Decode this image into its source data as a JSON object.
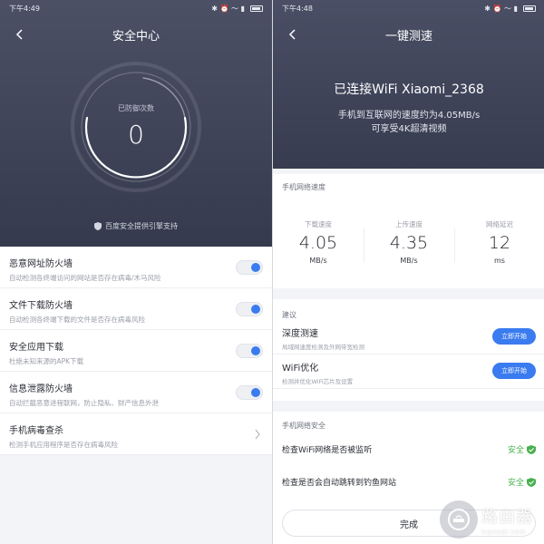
{
  "left": {
    "status": {
      "time": "下午4:49",
      "icons": "✱ ⏰ 〜 ▮"
    },
    "title": "安全中心",
    "ring": {
      "label": "已防御次数",
      "count": "0"
    },
    "powered_by": "百度安全提供引擎支持",
    "items": [
      {
        "title": "恶意网址防火墙",
        "desc": "自动检测各终端访问的网站是否存在病毒/木马风险",
        "enabled": true
      },
      {
        "title": "文件下载防火墙",
        "desc": "自动检测各终端下载的文件是否存在病毒风险",
        "enabled": true
      },
      {
        "title": "安全应用下载",
        "desc": "杜绝未知来源的APK下载",
        "enabled": true
      },
      {
        "title": "信息泄露防火墙",
        "desc": "自动拦截恶意进程联网，防止隐私、财产信息外泄",
        "enabled": true
      },
      {
        "title": "手机病毒查杀",
        "desc": "检测手机应用程序是否存在病毒风险"
      }
    ]
  },
  "right": {
    "status": {
      "time": "下午4:48",
      "icons": "✱ ⏰ 〜 ▮"
    },
    "title": "一键测速",
    "connected": "已连接WiFi Xiaomi_2368",
    "speed_line": "手机到互联网的速度约为4.05MB/s",
    "quality_line": "可享受4K超清视频",
    "speed_section": "手机网络速度",
    "metrics": [
      {
        "label": "下载速度",
        "value": "4.05",
        "unit": "MB/s"
      },
      {
        "label": "上传速度",
        "value": "4.35",
        "unit": "MB/s"
      },
      {
        "label": "网络延迟",
        "value": "12",
        "unit": "ms"
      }
    ],
    "suggest_section": "建议",
    "suggestions": [
      {
        "title": "深度测速",
        "desc": "局域网速度检测及外网带宽检测",
        "button": "立即开始"
      },
      {
        "title": "WiFi优化",
        "desc": "检测并优化WiFi芯片及设置",
        "button": "立即开始"
      }
    ],
    "security_section": "手机网络安全",
    "checks": [
      {
        "label": "检查WiFi网络是否被监听",
        "status": "安全"
      },
      {
        "label": "检查是否会自动跳转到钓鱼网站",
        "status": "安全"
      }
    ],
    "done_button": "完成"
  },
  "watermark": {
    "cn": "路由器",
    "en": "luyouqi.com"
  },
  "colors": {
    "accent": "#3a7bf0",
    "safe": "#49b04f",
    "header": "#3f4459"
  }
}
